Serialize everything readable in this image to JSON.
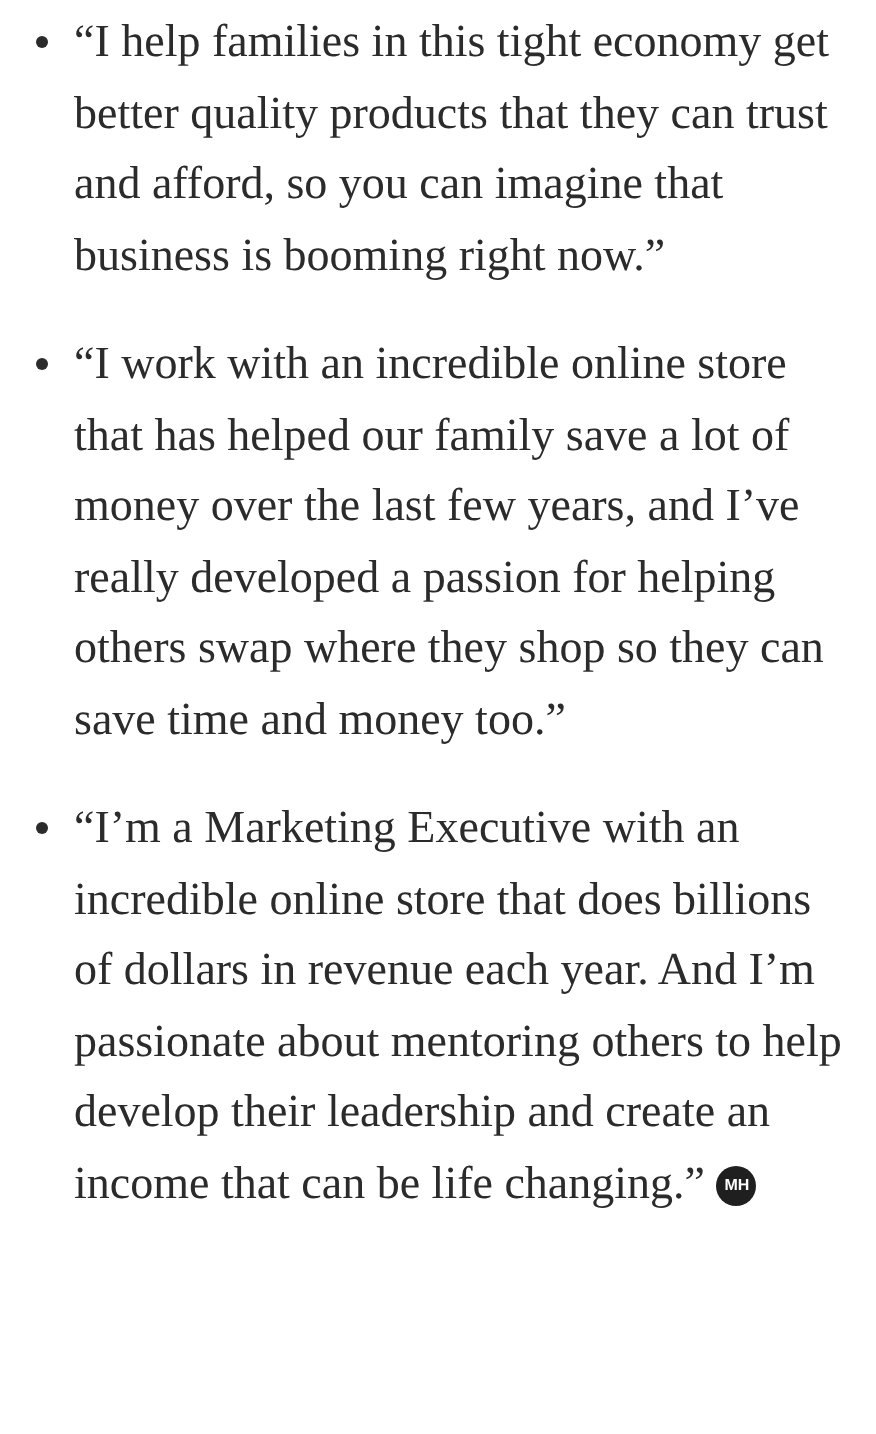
{
  "quotes": [
    {
      "text": "“I help families in this tight economy get better quality products that they can trust and afford, so you can imagine that business is booming right now.”"
    },
    {
      "text": "“I work with an incredible online store that has helped our family save a lot of money over the last few years, and I’ve really developed a passion for helping others swap where they shop so they can save time and money too.”"
    },
    {
      "text": "“I’m a Marketing Executive with an incredible online store that does billions of dollars in revenue each year. And I’m passionate about mentoring others to help develop their leadership and create an income that can be life changing.”",
      "badge": "MH"
    }
  ]
}
